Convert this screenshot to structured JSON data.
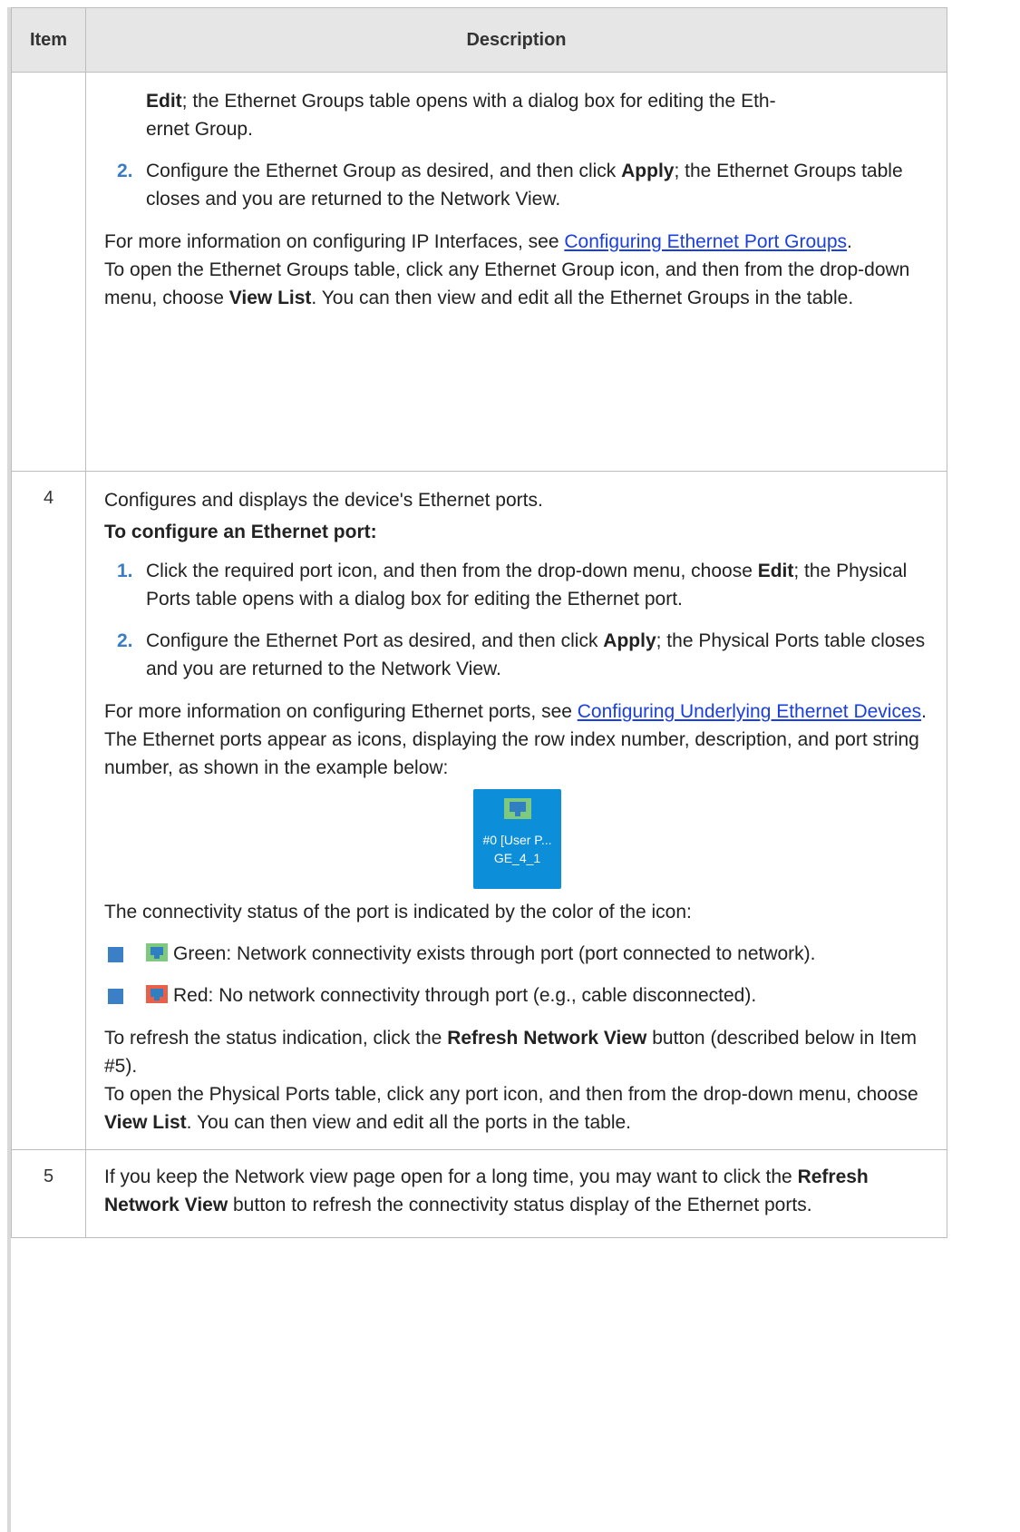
{
  "table": {
    "headers": {
      "item": "Item",
      "description": "Description"
    },
    "row3": {
      "step1_cont_bold": "Edit",
      "step1_cont_rest": "; the Ethernet Groups table opens with a dialog box for editing the Eth-",
      "step1_cont_line2": "ernet Group.",
      "step2_num": "2.",
      "step2_a": "Configure the Ethernet Group as desired, and then click ",
      "step2_bold": "Apply",
      "step2_b": "; the Ethernet Groups table closes and you are returned to the Network View.",
      "more_pre": "For more information on configuring IP Interfaces, see ",
      "more_link": "Configuring Ethernet Port Groups",
      "more_post": ".",
      "open_pre": "To open the Ethernet Groups table, click any Ethernet Group icon, and then from the drop-down menu, choose ",
      "open_bold": "View List",
      "open_post": ". You can then view and edit all the Ethernet Groups in the table."
    },
    "row4": {
      "item": "4",
      "intro": "Configures and displays the device's Ethernet ports.",
      "howto": "To configure an Ethernet port:",
      "step1_num": "1.",
      "step1_a": "Click the required port icon, and then from the drop-down menu, choose ",
      "step1_bold": "Edit",
      "step1_b": "; the Physical Ports table opens with a dialog box for editing the Ethernet port.",
      "step2_num": "2.",
      "step2_a": "Configure the Ethernet Port as desired, and then click ",
      "step2_bold": "Apply",
      "step2_b": "; the Physical Ports table closes and you are returned to the Network View.",
      "more_pre": "For more information on configuring Ethernet ports, see ",
      "more_link": "Configuring Underlying Ethernet Devices",
      "more_post": ".",
      "icons_text": "The Ethernet ports appear as icons, displaying the row index number, description, and port string number, as shown in the example below:",
      "port_tile": {
        "line1": "#0 [User P...",
        "line2": "GE_4_1",
        "icon": "ethernet-port-icon"
      },
      "status_intro": "The connectivity status of the port is indicated by the color of the icon:",
      "bullet_green": "Green: Network connectivity exists through port (port connected to network).",
      "bullet_red": "Red: No network connectivity through port (e.g., cable disconnected).",
      "refresh_pre": "To refresh the status indication, click the ",
      "refresh_bold": "Refresh Network View",
      "refresh_post": " button (described below in Item #5).",
      "open_pre": "To open the Physical Ports table, click any port icon, and then from the drop-down menu, choose ",
      "open_bold": "View List",
      "open_post": ". You can then view and edit all the ports in the table."
    },
    "row5": {
      "item": "5",
      "text_pre": "If you keep the Network view page open for a long time, you may want to click the ",
      "text_bold": "Refresh Network View",
      "text_post": " button to refresh the connectivity status display of the Ethernet ports."
    }
  },
  "colors": {
    "header_bg": "#e6e6e6",
    "border": "#bdbdbd",
    "link": "#1a3fe0",
    "step_number": "#3b7dc4",
    "bullet": "#3b80c7",
    "port_tile_bg": "#0d8ed8",
    "status_green": "#7fc97f",
    "status_red": "#e8604a"
  }
}
